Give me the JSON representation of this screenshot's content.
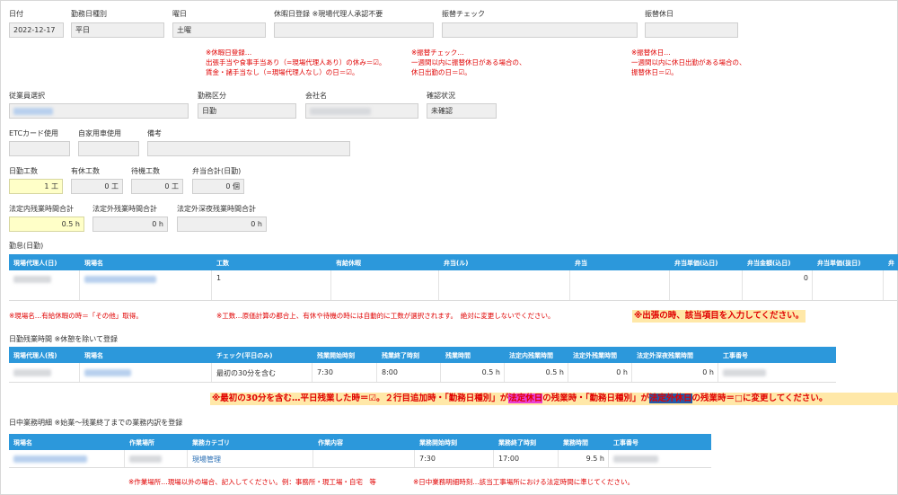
{
  "header_labels": {
    "date": "日付",
    "day_type": "勤務日種別",
    "weekday": "曜日",
    "holiday_reg": "休暇日登録 ※現場代理人承認不要",
    "swap_check": "振替チェック",
    "swap_holiday": "振替休日"
  },
  "header_values": {
    "date": "2022-12-17",
    "day_type": "平日",
    "weekday": "土曜"
  },
  "notes_top": {
    "holiday": [
      "※休暇日登録…",
      "出張手当や食事手当あり（=現場代理人あり）の休み＝☑。",
      "賃金・諸手当なし（=現場代理人なし）の日＝☑。"
    ],
    "swap": [
      "※振替チェック…",
      "一週間以内に振替休日がある場合の、",
      "休日出勤の日＝☑。"
    ],
    "swap_holiday": [
      "※振替休日…",
      "一週間以内に休日出勤がある場合の、",
      "振替休日＝☑。"
    ]
  },
  "emp_labels": {
    "employee": "従業員選択",
    "work_class": "勤務区分",
    "company": "会社名",
    "status": "確認状況"
  },
  "emp_values": {
    "work_class": "日勤",
    "status": "未確認"
  },
  "etc_labels": {
    "etc": "ETCカード使用",
    "car": "自家用車使用",
    "note": "備考"
  },
  "count_labels": {
    "day_work": "日勤工数",
    "paid": "有休工数",
    "standby": "待機工数",
    "bento": "弁当合計(日勤)"
  },
  "count_values": {
    "day_work": "1 工",
    "paid": "0 工",
    "standby": "0 工",
    "bento": "0 個"
  },
  "ot_labels": {
    "legal_in": "法定内残業時間合計",
    "legal_out": "法定外残業時間合計",
    "legal_out_night": "法定外深夜残業時間合計"
  },
  "ot_values": {
    "legal_in": "0.5 h",
    "legal_out": "0 h",
    "legal_out_night": "0 h"
  },
  "attendance": {
    "title": "勤怠(日勤)",
    "columns": [
      "現場代理人(日)",
      "現場名",
      "工数",
      "有給休暇",
      "弁当(ル)",
      "弁当",
      "弁当単価(込日)",
      "弁当金額(込日)",
      "弁当単価(抜日)",
      "弁"
    ],
    "row": {
      "kosu": "1",
      "amount": "0"
    },
    "note1": "※現場名…有給休暇の時＝「その他」取得。",
    "note2": "※工数…原価計算の都合上、有休や待機の時には自動的に工数が選択されます。　絶対に変更しないでください。",
    "banner": "※出張の時、該当項目を入力してください。"
  },
  "overtime": {
    "title": "日勤残業時間 ※休憩を除いて登録",
    "columns": [
      "現場代理人(残)",
      "現場名",
      "チェック(平日のみ)",
      "残業開始時刻",
      "残業終了時刻",
      "残業時間",
      "法定内残業時間",
      "法定外残業時間",
      "法定外深夜残業時間",
      "工事番号"
    ],
    "row": {
      "check": "最初の30分を含む",
      "start": "7:30",
      "end": "8:00",
      "hours": "0.5 h",
      "legal_in": "0.5 h",
      "legal_out": "0 h",
      "legal_out_night": "0 h"
    },
    "banner_a": "※最初の30分を含む…平日残業した時＝☑。２行目追加時・「勤務日種別」が",
    "banner_b": "法定休日",
    "banner_c": "の残業時・「勤務日種別」が",
    "banner_d": "法定外休日",
    "banner_e": "の残業時＝□に変更してください。"
  },
  "daytime": {
    "title": "日中業務明細 ※始業～残業終了までの業務内訳を登録",
    "columns": [
      "現場名",
      "作業場所",
      "業務カテゴリ",
      "作業内容",
      "業務開始時刻",
      "業務終了時刻",
      "業務時間",
      "工事番号"
    ],
    "row": {
      "category": "現場管理",
      "start": "7:30",
      "end": "17:00",
      "hours": "9.5 h"
    },
    "note1": "※作業場所…現場以外の場合、記入してください。例：事務所・現工場・自宅　等",
    "note2": "※日中業務明細時刻…該当工事場所における法定時間に準じてください。"
  },
  "colors": {
    "header_blue": "#2c98db",
    "red": "#e00000",
    "highlight": "#ffe8a8",
    "yellow_field": "#ffffc8"
  }
}
